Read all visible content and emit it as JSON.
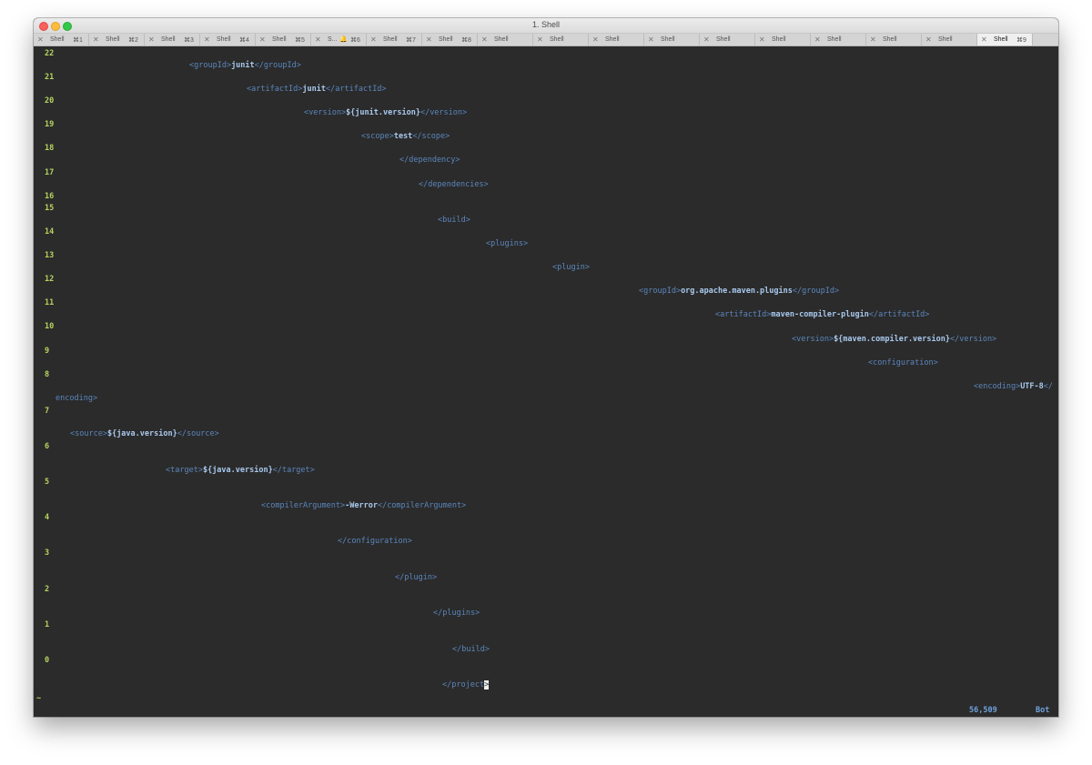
{
  "window": {
    "title": "1. Shell"
  },
  "tabs": [
    {
      "name": "Shell",
      "shortcut": "⌘1"
    },
    {
      "name": "Shell",
      "shortcut": "⌘2"
    },
    {
      "name": "Shell",
      "shortcut": "⌘3"
    },
    {
      "name": "Shell",
      "shortcut": "⌘4"
    },
    {
      "name": "Shell",
      "shortcut": "⌘5"
    },
    {
      "name": "S...",
      "shortcut": "⌘6",
      "bell": "🔔"
    },
    {
      "name": "Shell",
      "shortcut": "⌘7"
    },
    {
      "name": "Shell",
      "shortcut": "⌘8"
    },
    {
      "name": "Shell",
      "shortcut": ""
    },
    {
      "name": "Shell",
      "shortcut": ""
    },
    {
      "name": "Shell",
      "shortcut": ""
    },
    {
      "name": "Shell",
      "shortcut": ""
    },
    {
      "name": "Shell",
      "shortcut": ""
    },
    {
      "name": "Shell",
      "shortcut": ""
    },
    {
      "name": "Shell",
      "shortcut": ""
    },
    {
      "name": "Shell",
      "shortcut": ""
    },
    {
      "name": "Shell",
      "shortcut": ""
    },
    {
      "name": "Shell",
      "shortcut": "⌘9",
      "active": true
    }
  ],
  "tab_close_glyph": "✕",
  "editor": {
    "line_numbers": [
      "22",
      "21",
      "20",
      "19",
      "18",
      "17",
      "16",
      "15",
      "14",
      "13",
      "12",
      "11",
      "10",
      "9",
      "8",
      "7",
      "6",
      "5",
      "4",
      "3",
      "2",
      "1",
      "0"
    ],
    "lines": [
      {
        "segments": [
          {
            "t": "<groupId>"
          },
          {
            "t": "junit",
            "b": true
          },
          {
            "t": "</groupId>"
          }
        ]
      },
      {
        "segments": [
          {
            "t": "<artifactId>"
          },
          {
            "t": "junit",
            "b": true
          },
          {
            "t": "</artifactId>"
          }
        ]
      },
      {
        "segments": [
          {
            "t": "<version>"
          },
          {
            "t": "${junit.version}",
            "b": true
          },
          {
            "t": "</version>"
          }
        ]
      },
      {
        "segments": [
          {
            "t": "<scope>"
          },
          {
            "t": "test",
            "b": true
          },
          {
            "t": "</scope>"
          }
        ]
      },
      {
        "segments": [
          {
            "t": "</dependency>"
          }
        ]
      },
      {
        "segments": [
          {
            "t": "</dependencies>"
          }
        ]
      },
      {
        "segments": [
          {
            "t": "<build>"
          }
        ]
      },
      {
        "segments": [
          {
            "t": "<plugins>"
          }
        ]
      },
      {
        "segments": [
          {
            "t": "<plugin>"
          }
        ]
      },
      {
        "segments": [
          {
            "t": "<groupId>"
          },
          {
            "t": "org.apache.maven.plugins",
            "b": true
          },
          {
            "t": "</groupId>"
          }
        ]
      },
      {
        "segments": [
          {
            "t": "<artifactId>"
          },
          {
            "t": "maven-compiler-plugin",
            "b": true
          },
          {
            "t": "</artifactId>"
          }
        ]
      },
      {
        "segments": [
          {
            "t": "<version>"
          },
          {
            "t": "${maven.compiler.version}",
            "b": true
          },
          {
            "t": "</version>"
          }
        ]
      },
      {
        "segments": [
          {
            "t": "<configuration>"
          }
        ]
      },
      {
        "segments": [
          {
            "t": "<encoding>"
          },
          {
            "t": "UTF-8",
            "b": true
          },
          {
            "t": "</"
          }
        ]
      },
      {
        "segments": [
          {
            "t": "encoding>"
          }
        ]
      },
      {
        "segments": [
          {
            "t": "<source>"
          },
          {
            "t": "${java.version}",
            "b": true
          },
          {
            "t": "</source>"
          }
        ]
      },
      {
        "segments": [
          {
            "t": "<target>"
          },
          {
            "t": "${java.version}",
            "b": true
          },
          {
            "t": "</target>"
          }
        ]
      },
      {
        "segments": [
          {
            "t": "<compilerArgument>"
          },
          {
            "t": "-Werror",
            "b": true
          },
          {
            "t": "</compilerArgument>"
          }
        ]
      },
      {
        "segments": [
          {
            "t": "</configuration>"
          }
        ]
      },
      {
        "segments": [
          {
            "t": "</plugin>"
          }
        ]
      },
      {
        "segments": [
          {
            "t": "</plugins>"
          }
        ]
      },
      {
        "segments": [
          {
            "t": "</build>"
          }
        ]
      },
      {
        "segments": [
          {
            "t": "</project"
          },
          {
            "t": ">",
            "cursor": true
          }
        ]
      }
    ],
    "tilde": "~"
  },
  "statusline": {
    "position": "56,509",
    "scroll": "Bot"
  }
}
